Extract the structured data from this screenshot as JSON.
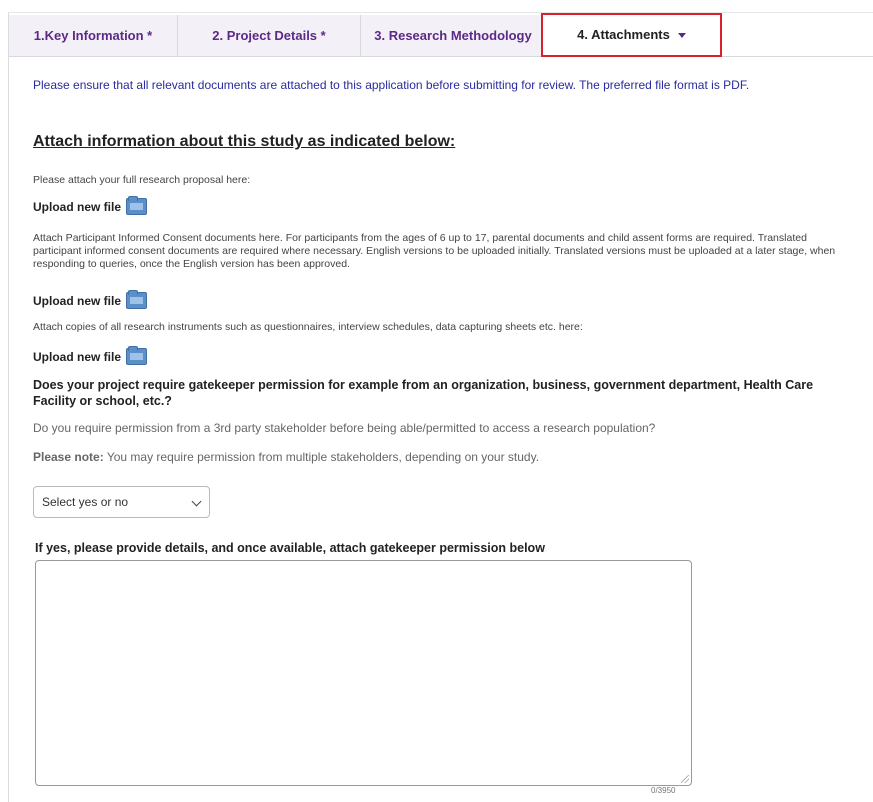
{
  "tabs": [
    {
      "label": "1.Key Information *"
    },
    {
      "label": "2. Project Details *"
    },
    {
      "label": "3. Research Methodology"
    },
    {
      "label": "4. Attachments"
    }
  ],
  "intro_text": "Please ensure that all relevant documents are attached to this application before submitting for review. The preferred file format is PDF.",
  "section_heading": "Attach information about this study as indicated below:",
  "proposal_text": "Please attach your full research proposal here:",
  "upload_label": "Upload new file",
  "consent_text": "Attach Participant Informed Consent documents here. For participants from the ages of 6 up to 17, parental documents and child assent forms are required. Translated participant informed consent documents are required where necessary. English versions to be uploaded initially. Translated versions must be uploaded at a later stage, when responding to queries, once the English version has been approved.",
  "instruments_text": "Attach copies of all research instruments such as questionnaires, interview schedules, data capturing sheets etc. here:",
  "gatekeeper_question": "Does your project require gatekeeper permission for example from an organization, business, government department, Health Care Facility or school, etc.?",
  "stakeholder_question": "Do you require permission from a 3rd party stakeholder before being able/permitted to access a research population?",
  "note_label": "Please note:",
  "note_text": " You may require permission from multiple stakeholders, depending on your study.",
  "select": {
    "value": "Select yes or no"
  },
  "details_label": "If yes, please provide details, and once available, attach gatekeeper permission below",
  "textarea": {
    "value": "",
    "counter": "0/3950"
  }
}
